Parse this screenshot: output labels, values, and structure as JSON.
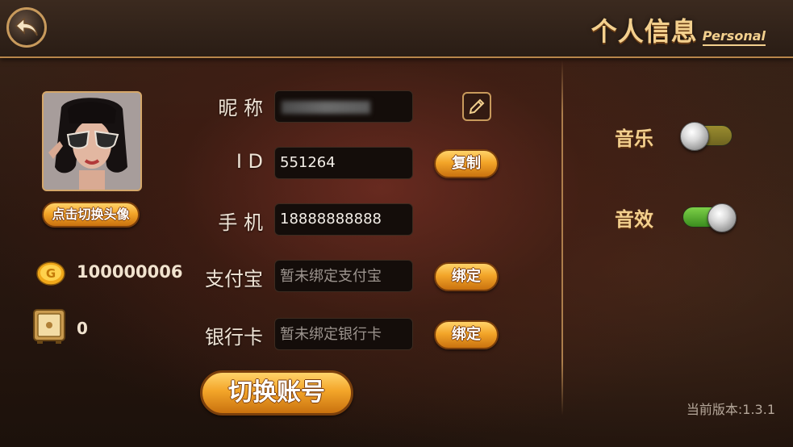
{
  "header": {
    "title_zh": "个人信息",
    "title_en": "Personal",
    "back_icon": "back-arrow-icon"
  },
  "profile": {
    "change_avatar_label": "点击切换头像",
    "coins": "100000006",
    "safe_value": "0"
  },
  "form": {
    "nickname_label": "昵 称",
    "nickname_value": "",
    "id_label": "I D",
    "id_value": "551264",
    "copy_label": "复制",
    "phone_label": "手 机",
    "phone_value": "18888888888",
    "alipay_label": "支付宝",
    "alipay_placeholder": "暂未绑定支付宝",
    "alipay_bind_label": "绑定",
    "bank_label": "银行卡",
    "bank_placeholder": "暂未绑定银行卡",
    "bank_bind_label": "绑定",
    "switch_account_label": "切换账号"
  },
  "settings": {
    "music_label": "音乐",
    "music_on": false,
    "sfx_label": "音效",
    "sfx_on": true
  },
  "version_text": "当前版本:1.3.1",
  "colors": {
    "gold": "#f3d08e",
    "button_orange": "#f3a529"
  }
}
